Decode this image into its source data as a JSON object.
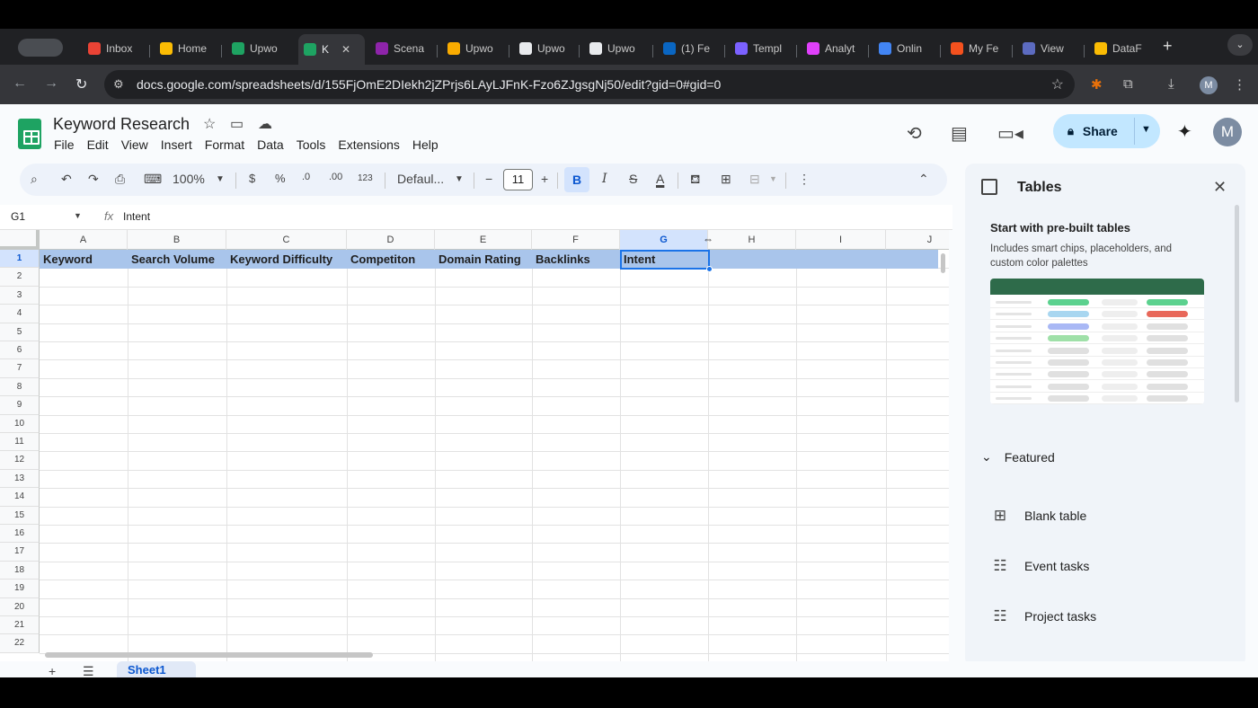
{
  "browser": {
    "tabs": [
      {
        "label": "Inbox",
        "color": "#ea4335"
      },
      {
        "label": "Home",
        "color": "#fbbc04"
      },
      {
        "label": "Upwo",
        "color": "#1ea362"
      },
      {
        "label": "K",
        "color": "#1ea362"
      },
      {
        "label": "Scena",
        "color": "#8e24aa"
      },
      {
        "label": "Upwo",
        "color": "#f9ab00"
      },
      {
        "label": "Upwo",
        "color": "#e8eaed"
      },
      {
        "label": "Upwo",
        "color": "#e8eaed"
      },
      {
        "label": "(1) Fe",
        "color": "#0a66c2"
      },
      {
        "label": "Templ",
        "color": "#7b61ff"
      },
      {
        "label": "Analyt",
        "color": "#e040fb"
      },
      {
        "label": "Onlin",
        "color": "#4285f4"
      },
      {
        "label": "My Fe",
        "color": "#f4511e"
      },
      {
        "label": "View",
        "color": "#5c6bc0"
      },
      {
        "label": "DataF",
        "color": "#fbbc04"
      }
    ],
    "url": "docs.google.com/spreadsheets/d/155FjOmE2DIekh2jZPrjs6LAyLJFnK-Fzo6ZJgsgNj50/edit?gid=0#gid=0",
    "profile_initial": "M"
  },
  "doc": {
    "title": "Keyword Research",
    "menu": [
      "File",
      "Edit",
      "View",
      "Insert",
      "Format",
      "Data",
      "Tools",
      "Extensions",
      "Help"
    ],
    "share_label": "Share",
    "avatar_initial": "M"
  },
  "format_bar": {
    "zoom": "100%",
    "currency": "$",
    "percent": "%",
    "dec_decrease": ".0",
    "dec_increase": ".00",
    "number_format": "123",
    "font": "Defaul...",
    "font_size": "11",
    "bold": "B",
    "italic": "I",
    "strike": "S",
    "text_color": "A"
  },
  "formula_bar": {
    "name_box": "G1",
    "fx": "fx",
    "value": "Intent"
  },
  "grid": {
    "columns": [
      "A",
      "B",
      "C",
      "D",
      "E",
      "F",
      "G",
      "H",
      "I",
      "J"
    ],
    "selected_column": "G",
    "rows": [
      "1",
      "2",
      "3",
      "4",
      "5",
      "6",
      "7",
      "8",
      "9",
      "10",
      "11",
      "12",
      "13",
      "14",
      "15",
      "16",
      "17",
      "18",
      "19",
      "20",
      "21",
      "22"
    ],
    "row1": [
      "Keyword",
      "Search Volume",
      "Keyword Difficulty",
      "Competiton",
      "Domain Rating",
      "Backlinks",
      "Intent"
    ]
  },
  "side_panel": {
    "title": "Tables",
    "subtitle": "Start with pre-built tables",
    "description": "Includes smart chips, placeholders, and custom color palettes",
    "featured_label": "Featured",
    "items": [
      "Blank table",
      "Event tasks",
      "Project tasks"
    ]
  },
  "sheet_tab": "Sheet1"
}
